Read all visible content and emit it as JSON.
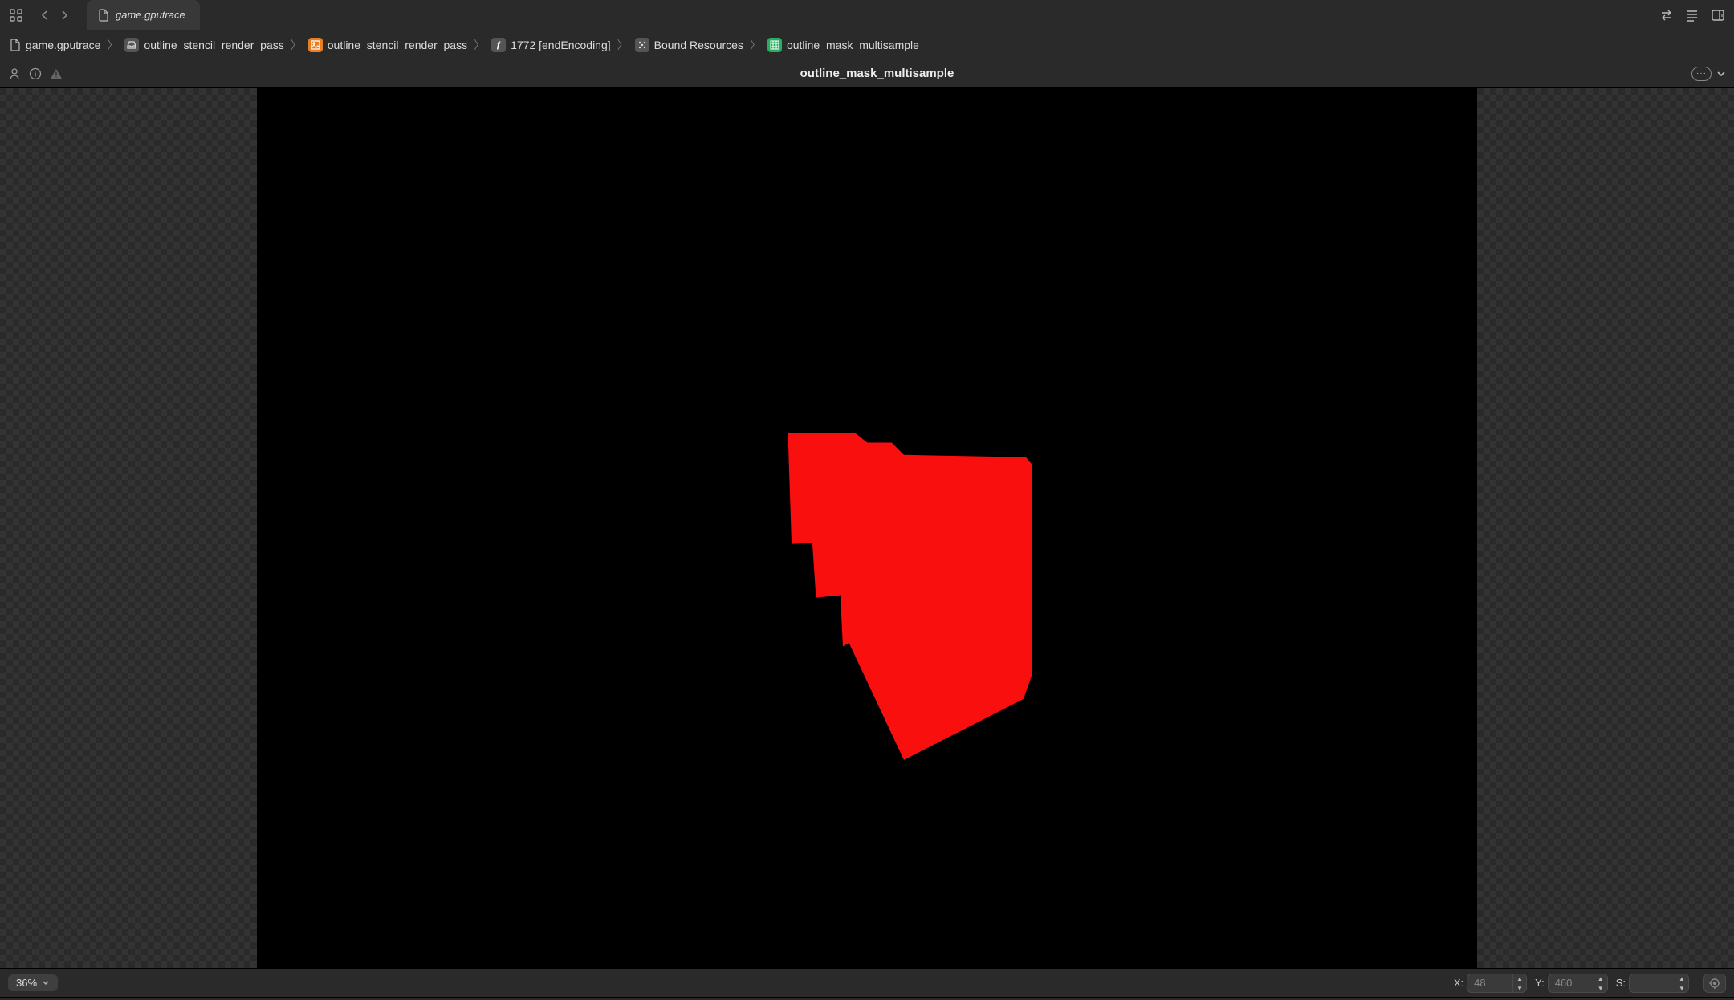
{
  "tab": {
    "title": "game.gputrace"
  },
  "breadcrumb": {
    "items": [
      {
        "icon": "file",
        "label": "game.gputrace"
      },
      {
        "icon": "inbox",
        "label": "outline_stencil_render_pass"
      },
      {
        "icon": "image",
        "label": "outline_stencil_render_pass"
      },
      {
        "icon": "func",
        "label": "1772 [endEncoding]"
      },
      {
        "icon": "die",
        "label": "Bound Resources"
      },
      {
        "icon": "tex",
        "label": "outline_mask_multisample"
      }
    ]
  },
  "titlebar": {
    "title": "outline_mask_multisample"
  },
  "statusbar": {
    "zoom": "36%",
    "x_label": "X:",
    "y_label": "Y:",
    "s_label": "S:",
    "x_placeholder": "48",
    "y_placeholder": "460"
  }
}
